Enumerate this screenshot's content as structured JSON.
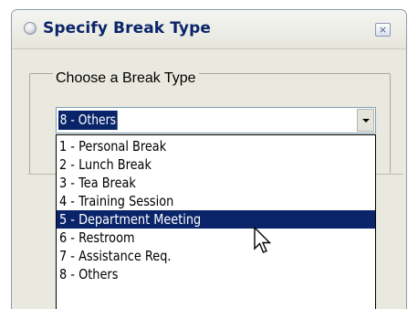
{
  "dialog": {
    "title": "Specify Break Type",
    "close_label": "×"
  },
  "group": {
    "legend": "Choose a Break Type"
  },
  "select": {
    "value": "8 - Others"
  },
  "list": {
    "items": [
      {
        "label": "1 - Personal Break"
      },
      {
        "label": "2 - Lunch Break"
      },
      {
        "label": "3 - Tea Break"
      },
      {
        "label": "4 - Training Session"
      },
      {
        "label": "5 - Department Meeting"
      },
      {
        "label": "6 - Restroom"
      },
      {
        "label": "7 - Assistance Req."
      },
      {
        "label": "8 - Others"
      }
    ],
    "highlighted": "5 - Department Meeting"
  },
  "colors": {
    "title_text": "#0a246a",
    "selection_bg": "#0a246a",
    "dialog_bg": "#eae9df"
  }
}
